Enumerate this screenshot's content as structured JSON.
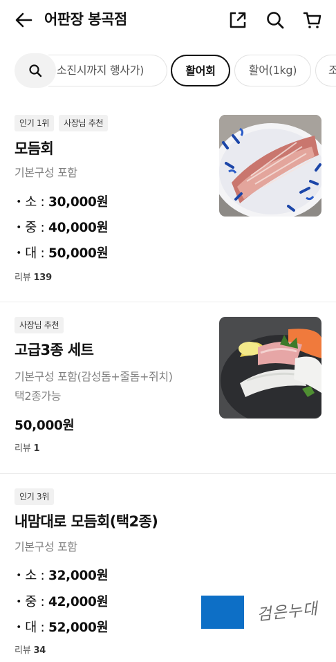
{
  "header": {
    "title": "어판장 봉곡점"
  },
  "category_tabs": [
    {
      "label": "소진시까지 행사가)",
      "active": false
    },
    {
      "label": "활어회",
      "active": true
    },
    {
      "label": "활어(1kg)",
      "active": false
    },
    {
      "label": "조",
      "active": false
    }
  ],
  "menu_items": [
    {
      "badges": [
        "인기 1위",
        "사장님 추천"
      ],
      "name": "모듬회",
      "description": [
        "기본구성 포함"
      ],
      "prices": [
        {
          "size": "・소 : ",
          "price": "30,000원"
        },
        {
          "size": "・중 : ",
          "price": "40,000원"
        },
        {
          "size": "・대 : ",
          "price": "50,000원"
        }
      ],
      "review_label": "리뷰 ",
      "review_count": "139"
    },
    {
      "badges": [
        "사장님 추천"
      ],
      "name": "고급3종 세트",
      "description": [
        "기본구성 포함(감성돔+줄돔+쥐치)",
        "택2종가능"
      ],
      "price": "50,000원",
      "review_label": "리뷰 ",
      "review_count": "1"
    },
    {
      "badges": [
        "인기 3위"
      ],
      "name": "내맘대로 모듬회(택2종)",
      "description": [
        "기본구성 포함"
      ],
      "prices": [
        {
          "size": "・소 : ",
          "price": "32,000원"
        },
        {
          "size": "・중 : ",
          "price": "42,000원"
        },
        {
          "size": "・대 : ",
          "price": "52,000원"
        }
      ],
      "review_label": "리뷰 ",
      "review_count": "34"
    }
  ],
  "watermark": {
    "text": "검은누대",
    "color": "#0d6fc6"
  }
}
